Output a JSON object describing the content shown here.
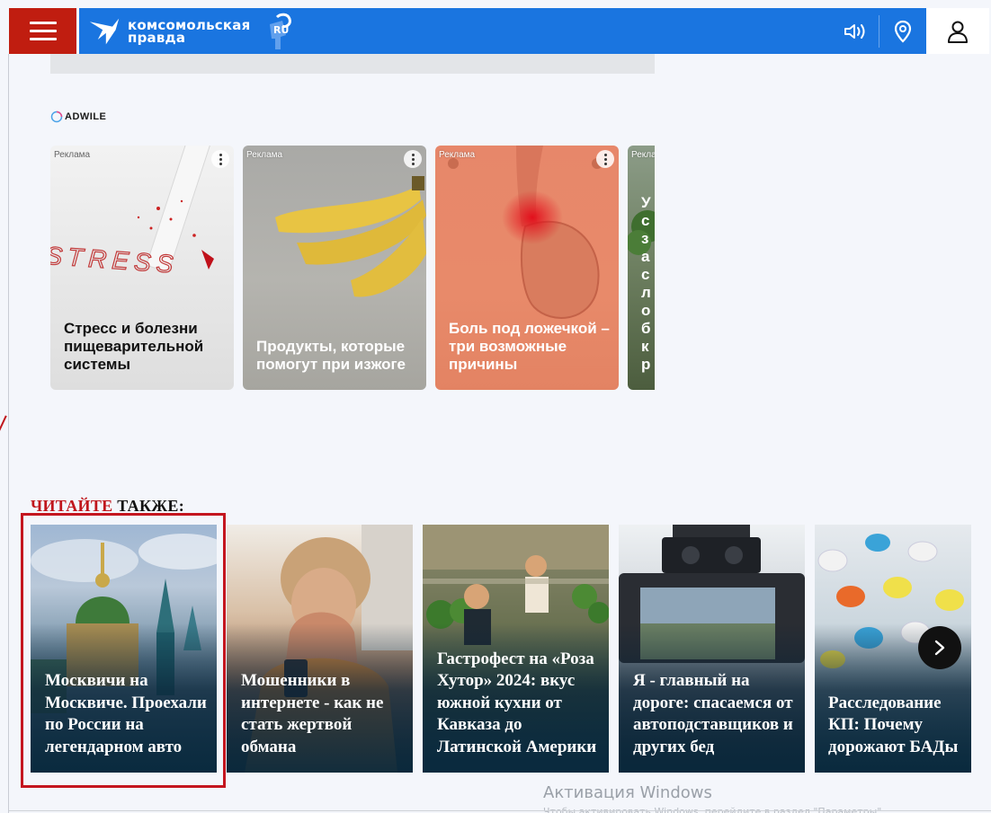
{
  "header": {
    "brand_line1": "комсомольская",
    "brand_line2": "правда",
    "brand_domain": "RU",
    "menu_icon": "hamburger-icon",
    "icons": [
      "speaker-icon",
      "location-pin-icon",
      "user-icon"
    ],
    "colors": {
      "brand_blue": "#1a75e0",
      "menu_red": "#c01d10"
    }
  },
  "ads": {
    "provider": "ADWILE",
    "label": "Реклама",
    "cards": [
      {
        "title": "Стресс и болезни пищеварительной системы",
        "title_color": "#111111"
      },
      {
        "title": "Продукты, которые помогут при изжоге",
        "title_color": "#ffffff"
      },
      {
        "title": "Боль под ложечкой – три возможные причины",
        "title_color": "#ffffff"
      },
      {
        "title": "Ус за сл об кр",
        "title_color": "#ffffff"
      }
    ]
  },
  "read_also": {
    "title_red": "ЧИТАЙТЕ",
    "title_rest": " ТАКЖЕ:",
    "cards": [
      {
        "title": "Москвичи на Москвиче. Проехали по России на легендарном авто",
        "selected": true
      },
      {
        "title": "Мошенники в интернете - как не стать жертвой обмана",
        "selected": false
      },
      {
        "title": "Гастрофест на «Роза Хутор» 2024: вкус южной кухни от Кавказа до Латинской Америки",
        "selected": false
      },
      {
        "title": "Я - главный на дороге: спасаемся от автоподставщиков и других бед",
        "selected": false
      },
      {
        "title": "Расследование КП: Почему дорожают БАДы",
        "selected": false
      }
    ],
    "next_icon": "chevron-right-icon",
    "highlight_color": "#c4161f"
  },
  "windows": {
    "activation_title": "Активация Windows",
    "activation_sub": "Чтобы активировать Windows, перейдите в раздел \"Параметры\"."
  }
}
